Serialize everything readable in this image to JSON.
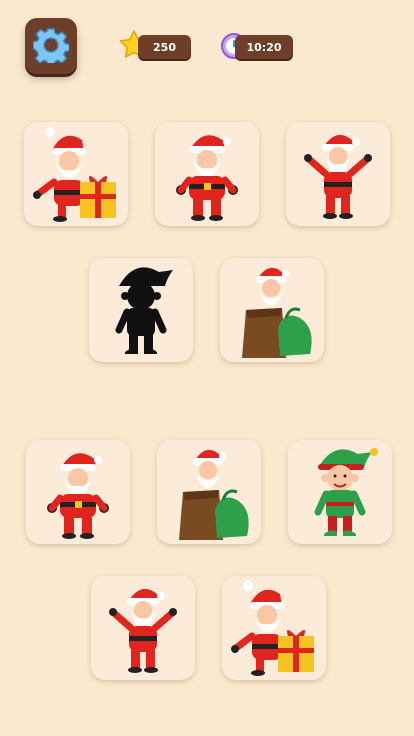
{
  "hud": {
    "coins": "250",
    "timer": "10:20",
    "settings_icon": "gear-icon",
    "coin_icon": "star-icon",
    "timer_icon": "clock-icon"
  },
  "target_board": {
    "row1": [
      "santa-with-gift",
      "santa-hands-on-belt",
      "santa-waving"
    ],
    "row2": [
      "elf-silhouette",
      "santa-in-sack"
    ]
  },
  "choice_board": {
    "row1": [
      "santa-hands-on-belt",
      "santa-in-sack",
      "elf"
    ],
    "row2": [
      "santa-waving",
      "santa-with-gift"
    ]
  },
  "colors": {
    "background": "#FBE9CF",
    "card": "#FBEBD8",
    "button": "#6E3F28",
    "santa_red": "#E0251F"
  }
}
